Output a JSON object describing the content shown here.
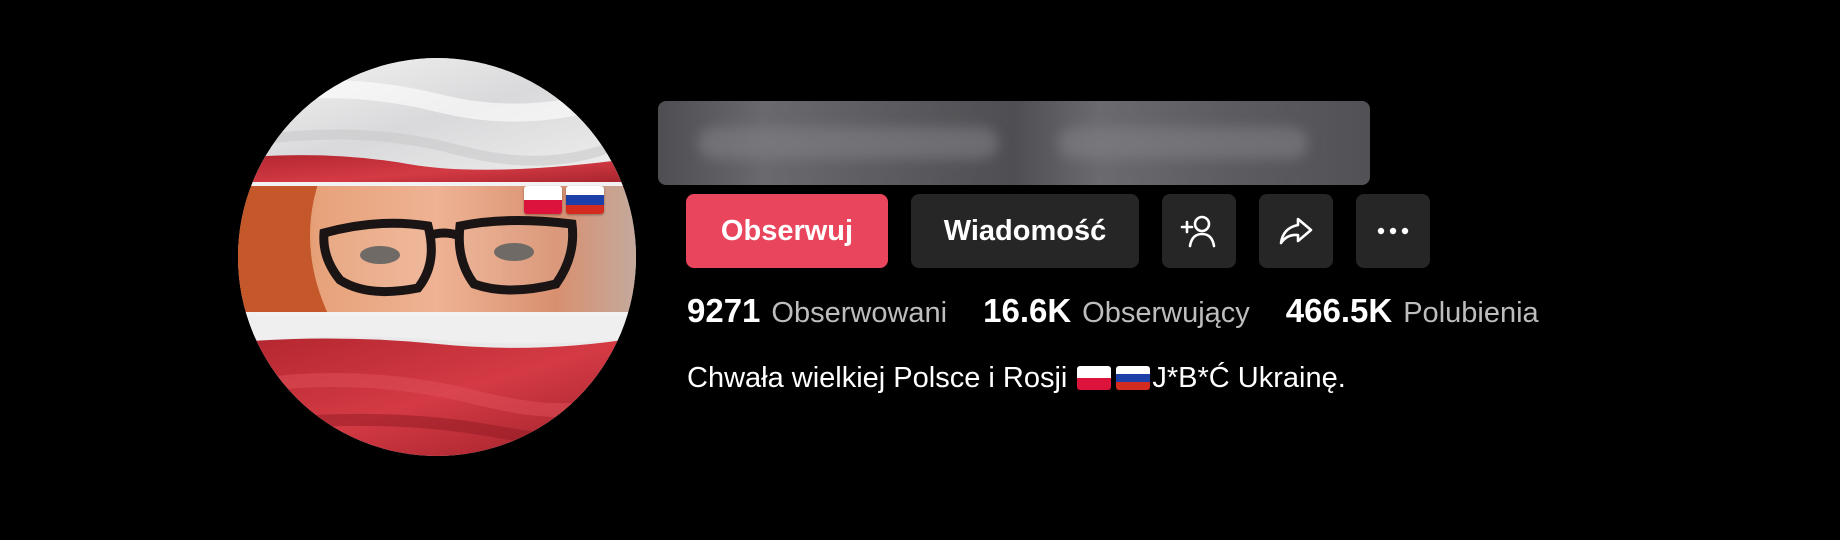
{
  "profile": {
    "flag_colors": {
      "poland": [
        "#ffffff",
        "#dc143c"
      ],
      "russia": [
        "#ffffff",
        "#1c3fa8",
        "#d52b1e"
      ]
    }
  },
  "actions": {
    "follow_label": "Obserwuj",
    "message_label": "Wiadomość",
    "add_friend_icon": "add-user-icon",
    "share_icon": "share-icon",
    "more_icon": "more-icon"
  },
  "stats": [
    {
      "value": "9271",
      "label": "Obserwowani"
    },
    {
      "value": "16.6K",
      "label": "Obserwujący"
    },
    {
      "value": "466.5K",
      "label": "Polubienia"
    }
  ],
  "bio": {
    "text_before": "Chwała wielkiej Polsce i Rosji",
    "flags": [
      "poland",
      "russia"
    ],
    "text_after": "J*B*Ć Ukrainę."
  },
  "colors": {
    "background": "#000000",
    "follow_button": "#e9455d",
    "secondary_button": "#262626",
    "stat_label": "#bdbdbd"
  }
}
